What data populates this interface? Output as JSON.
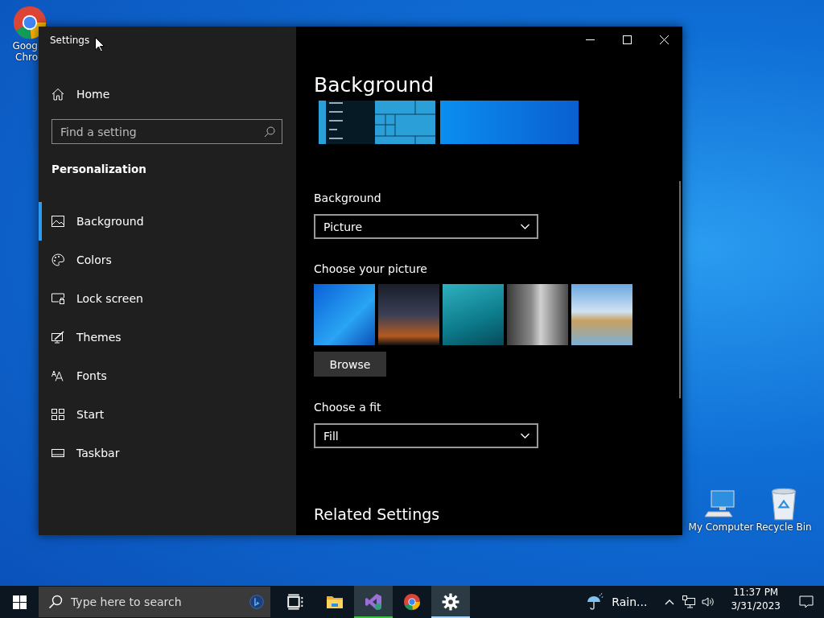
{
  "desktop": {
    "left_icons": [
      {
        "kind": "chrome",
        "lines": [
          "Goog",
          "Chro"
        ]
      }
    ],
    "right_icons": [
      {
        "kind": "computer",
        "label": "My Computer"
      },
      {
        "kind": "recycle",
        "label": "Recycle Bin"
      }
    ]
  },
  "window": {
    "title": "Settings"
  },
  "sidebar": {
    "home": "Home",
    "search": {
      "placeholder": "Find a setting"
    },
    "section": "Personalization",
    "items": [
      {
        "kind": "picture",
        "label": "Background",
        "selected": true
      },
      {
        "kind": "palette",
        "label": "Colors",
        "selected": false
      },
      {
        "kind": "lock",
        "label": "Lock screen",
        "selected": false
      },
      {
        "kind": "themes",
        "label": "Themes",
        "selected": false
      },
      {
        "kind": "fonts",
        "label": "Fonts",
        "selected": false
      },
      {
        "kind": "start",
        "label": "Start",
        "selected": false
      },
      {
        "kind": "taskbar",
        "label": "Taskbar",
        "selected": false
      }
    ]
  },
  "content": {
    "heading": "Background",
    "background_label": "Background",
    "background_value": "Picture",
    "picture_label": "Choose your picture",
    "pictures": [
      {
        "kind": "windows"
      },
      {
        "kind": "night"
      },
      {
        "kind": "water"
      },
      {
        "kind": "rock"
      },
      {
        "kind": "beach"
      }
    ],
    "browse": "Browse",
    "fit_label": "Choose a fit",
    "fit_value": "Fill",
    "related_heading": "Related Settings"
  },
  "taskbar": {
    "search_placeholder": "Type here to search",
    "apps": [
      {
        "kind": "taskview",
        "active": false
      },
      {
        "kind": "folder",
        "active": false
      },
      {
        "kind": "vs",
        "active": true,
        "color": "#3fbf3f"
      },
      {
        "kind": "chrome",
        "active": false
      },
      {
        "kind": "gear",
        "active": true,
        "color": "#9fd4ff"
      }
    ],
    "weather": "Rain...",
    "time": "11:37 PM",
    "date": "3/31/2023"
  }
}
